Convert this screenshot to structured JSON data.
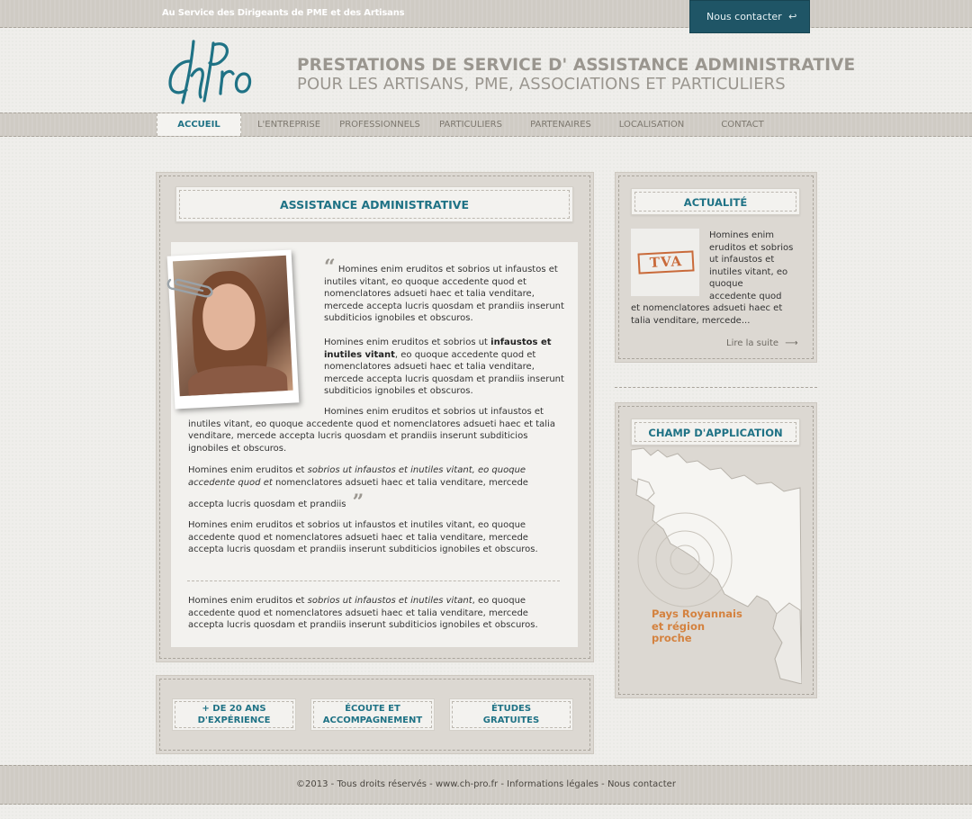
{
  "topbar": {
    "tagline": "Au Service des Dirigeants de PME et des Artisans",
    "contact_label": "Nous contacter"
  },
  "header": {
    "logo_text": "ChPro",
    "title_line1": "PRESTATIONS DE SERVICE D' ASSISTANCE  ADMINISTRATIVE",
    "title_line2": "POUR LES ARTISANS, PME, ASSOCIATIONS ET PARTICULIERS"
  },
  "nav": {
    "items": [
      {
        "label": "ACCUEIL",
        "active": true
      },
      {
        "label": "L'ENTREPRISE"
      },
      {
        "label": "PROFESSIONNELS"
      },
      {
        "label": "PARTICULIERS"
      },
      {
        "label": "PARTENAIRES"
      },
      {
        "label": "LOCALISATION"
      },
      {
        "label": "CONTACT"
      }
    ]
  },
  "main": {
    "heading": "ASSISTANCE ADMINISTRATIVE",
    "paragraphs": {
      "p1": "Homines enim eruditos et sobrios ut infaustos et inutiles vitant, eo quoque accedente quod et nomenclatores adsueti haec et talia venditare, mercede accepta lucris quosdam et prandiis inserunt subditicios ignobiles et obscuros.",
      "p2_before": "Homines enim eruditos et sobrios ut ",
      "p2_bold": "infaustos et inutiles vitant",
      "p2_after": ", eo quoque accedente quod et nomenclatores adsueti haec et talia venditare, mercede accepta lucris quosdam et prandiis inserunt subditicios ignobiles et obscuros.",
      "p3": "Homines enim eruditos et sobrios ut infaustos et inutiles vitant, eo quoque accedente quod et nomenclatores adsueti haec et talia venditare, mercede accepta lucris quosdam et prandiis inserunt subditicios ignobiles et obscuros.",
      "p4_before": "Homines enim eruditos et ",
      "p4_italic": "sobrios ut infaustos et inutiles vitant, eo quoque accedente quod et",
      "p4_after": " nomenclatores adsueti haec et talia venditare, mercede",
      "p4_end": "accepta lucris quosdam et prandiis",
      "p5": "Homines enim eruditos et sobrios ut infaustos et inutiles vitant, eo quoque accedente quod et nomenclatores adsueti haec et talia venditare, mercede accepta lucris quosdam et prandiis inserunt subditicios ignobiles et obscuros.",
      "p6_before": "Homines enim eruditos et ",
      "p6_italic": "sobrios ut infaustos et inutiles vitant",
      "p6_after": ", eo quoque accedente quod et nomenclatores adsueti haec et talia venditare, mercede accepta lucris quosdam et prandiis inserunt subditicios ignobiles et obscuros."
    },
    "features": [
      {
        "line1": "+ DE 20 ANS",
        "line2": "D'EXPÉRIENCE"
      },
      {
        "line1": "ÉCOUTE ET",
        "line2": "ACCOMPAGNEMENT"
      },
      {
        "line1": "ÉTUDES",
        "line2": "GRATUITES"
      }
    ]
  },
  "news": {
    "heading": "ACTUALITÉ",
    "stamp": "TVA",
    "text_col": [
      "Homines enim",
      "eruditos et sobrios",
      "ut infaustos et",
      "inutiles vitant, eo",
      "quoque",
      "accedente quod"
    ],
    "text_full": "et nomenclatores adsueti haec et talia venditare, mercede...",
    "read_more": "Lire la suite"
  },
  "map": {
    "heading": "CHAMP D'APPLICATION",
    "label_lines": [
      "Pays Royannais",
      "et région",
      "proche"
    ]
  },
  "footer": {
    "copyright": "©2013 - Tous droits réservés - ",
    "site": "www.ch-pro.fr",
    "sep1": " - ",
    "legal": "Informations légales",
    "sep2": " - ",
    "contact": "Nous contacter"
  },
  "colors": {
    "accent_teal": "#1f7285",
    "contact_tab": "#1f5566",
    "map_label_orange": "#d4823f",
    "title_grey": "#9a968f"
  }
}
